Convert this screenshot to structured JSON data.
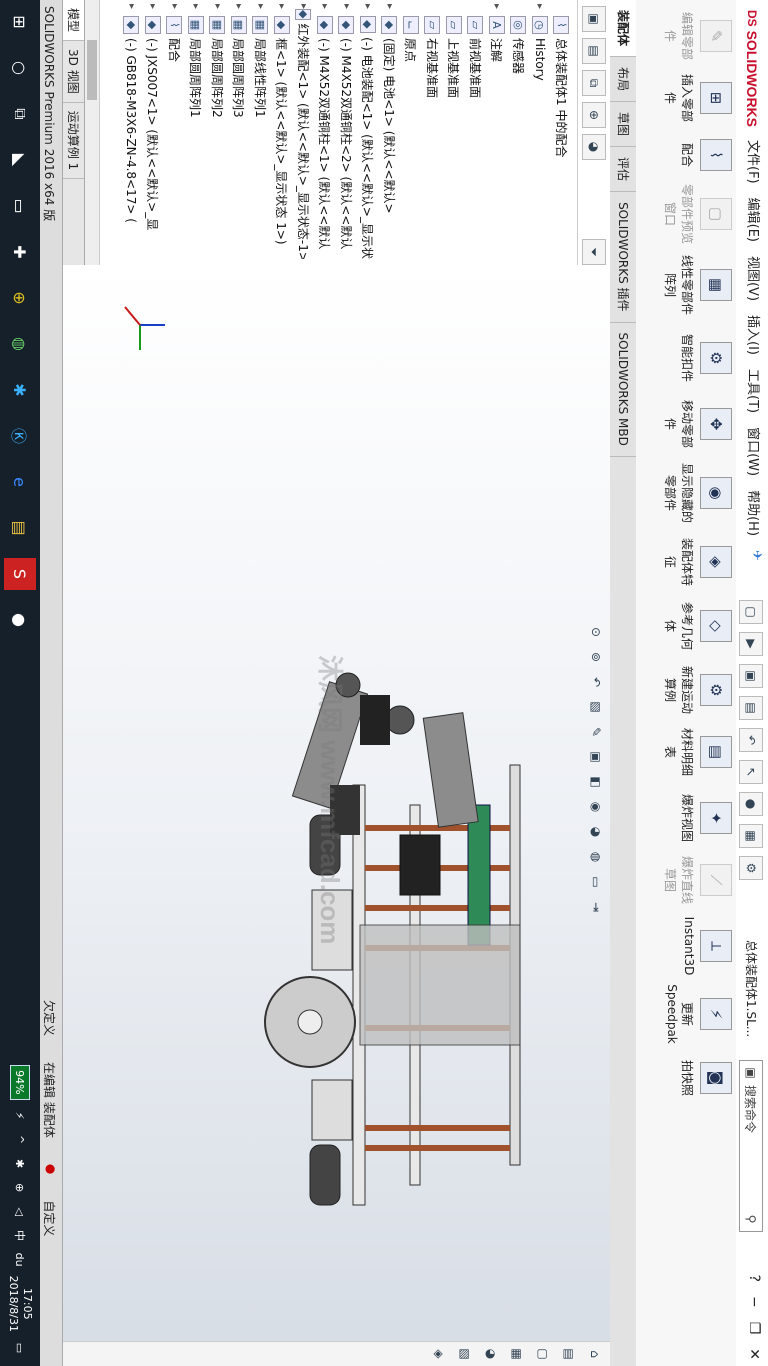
{
  "app": {
    "logo_text": "SOLIDWORKS",
    "logo_mark": "DS",
    "document_title": "总体装配体1.SL...",
    "window_caption": "SOLIDWORKS Premium 2016 x64 版"
  },
  "menu": [
    "文件(F)",
    "编辑(E)",
    "视图(V)",
    "插入(I)",
    "工具(T)",
    "窗口(W)",
    "帮助(H)"
  ],
  "search": {
    "placeholder": "搜索命令"
  },
  "commands": [
    {
      "label": "编辑零部件",
      "enabled": false
    },
    {
      "label": "插入零部件",
      "enabled": true
    },
    {
      "label": "配合",
      "enabled": true
    },
    {
      "label": "零部件预览窗口",
      "enabled": false
    },
    {
      "label": "线性零部件阵列",
      "enabled": true
    },
    {
      "label": "智能扣件",
      "enabled": true
    },
    {
      "label": "移动零部件",
      "enabled": true
    },
    {
      "label": "显示隐藏的零部件",
      "enabled": true
    },
    {
      "label": "装配体特征",
      "enabled": true
    },
    {
      "label": "参考几何体",
      "enabled": true
    },
    {
      "label": "新建运动算例",
      "enabled": true
    },
    {
      "label": "材料明细表",
      "enabled": true
    },
    {
      "label": "爆炸视图",
      "enabled": true
    },
    {
      "label": "爆炸直线草图",
      "enabled": false
    },
    {
      "label": "Instant3D",
      "enabled": true
    },
    {
      "label": "更新 Speedpak",
      "enabled": true
    },
    {
      "label": "拍快照",
      "enabled": true
    }
  ],
  "tabs": [
    "装配体",
    "布局",
    "草图",
    "评估",
    "SOLIDWORKS 插件",
    "SOLIDWORKS MBD"
  ],
  "tree": [
    {
      "label": "总体装配体1 中的配合",
      "icon": "assembly"
    },
    {
      "label": "History",
      "icon": "folder"
    },
    {
      "label": "传感器",
      "icon": "folder"
    },
    {
      "label": "注解",
      "icon": "folder"
    },
    {
      "label": "前视基准面",
      "icon": "plane"
    },
    {
      "label": "上视基准面",
      "icon": "plane"
    },
    {
      "label": "右视基准面",
      "icon": "plane"
    },
    {
      "label": "原点",
      "icon": "origin"
    },
    {
      "label": "(固定) 电池<1> (默认<<默认>",
      "icon": "part"
    },
    {
      "label": "(-) 电池装配<1> (默认<<默认>_显示状",
      "icon": "part"
    },
    {
      "label": "(-) M4X52双通铜柱<2> (默认<<默认",
      "icon": "part"
    },
    {
      "label": "(-) M4X52双通铜柱<1> (默认<<默认",
      "icon": "part"
    },
    {
      "label": "红外装配<1> (默认<<默认>_显示状态-1>",
      "icon": "part"
    },
    {
      "label": "框<1> (默认<<默认>_显示状态 1>)",
      "icon": "part"
    },
    {
      "label": "局部线性阵列1",
      "icon": "pattern"
    },
    {
      "label": "局部圆周阵列3",
      "icon": "pattern"
    },
    {
      "label": "局部圆周阵列2",
      "icon": "pattern"
    },
    {
      "label": "局部圆周阵列1",
      "icon": "pattern"
    },
    {
      "label": "配合",
      "icon": "mate"
    },
    {
      "label": "(-) JXS007<1> (默认<<默认>_显",
      "icon": "part"
    },
    {
      "label": "(-) GB818-M3X6-ZN-4.8<17> (",
      "icon": "part"
    }
  ],
  "model_tabs": [
    "模型",
    "3D 视图",
    "运动算例 1"
  ],
  "status": {
    "left": "SOLIDWORKS Premium 2016 x64 版",
    "state": "欠定义",
    "mode": "在编辑 装配体",
    "custom": "自定义"
  },
  "watermark": "沐风网 www.mfcad.com",
  "tray": {
    "battery": "94%",
    "time": "17:05",
    "date": "2018/8/31"
  },
  "taskbar": [
    "windows-icon",
    "search-icon",
    "task-view-icon",
    "app-icon",
    "window-icon",
    "puzzle-icon",
    "green-plus-icon",
    "wechat-icon",
    "bluetooth-icon",
    "app-k-icon",
    "edge-icon",
    "folder-icon",
    "solidworks-icon",
    "avatar-icon"
  ]
}
